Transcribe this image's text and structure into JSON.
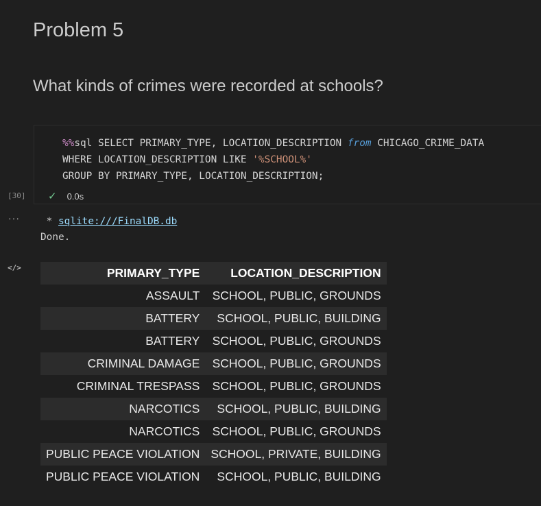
{
  "markdown": {
    "heading": "Problem 5",
    "question": "What kinds of crimes were recorded at schools?"
  },
  "code_cell": {
    "line1_magic": "%%",
    "line1_a": "sql SELECT PRIMARY_TYPE",
    "line1_b": ", LOCATION_DESCRIPTION ",
    "line1_kw": "from",
    "line1_c": " CHICAGO_CRIME_DATA",
    "line2_a": "WHERE LOCATION_DESCRIPTION LIKE ",
    "line2_str": "'%SCHOOL%'",
    "line3_a": "GROUP BY PRIMARY_TYPE",
    "line3_b": ", LOCATION_DESCRIPTION",
    "line3_semi": ";",
    "execution_count": "[30]",
    "status_time": "0.0s"
  },
  "output": {
    "connection_prefix": " * ",
    "connection_link": "sqlite:///FinalDB.db",
    "done_text": "Done."
  },
  "table": {
    "headers": [
      "PRIMARY_TYPE",
      "LOCATION_DESCRIPTION"
    ],
    "rows": [
      [
        "ASSAULT",
        "SCHOOL, PUBLIC, GROUNDS"
      ],
      [
        "BATTERY",
        "SCHOOL, PUBLIC, BUILDING"
      ],
      [
        "BATTERY",
        "SCHOOL, PUBLIC, GROUNDS"
      ],
      [
        "CRIMINAL DAMAGE",
        "SCHOOL, PUBLIC, GROUNDS"
      ],
      [
        "CRIMINAL TRESPASS",
        "SCHOOL, PUBLIC, GROUNDS"
      ],
      [
        "NARCOTICS",
        "SCHOOL, PUBLIC, BUILDING"
      ],
      [
        "NARCOTICS",
        "SCHOOL, PUBLIC, GROUNDS"
      ],
      [
        "PUBLIC PEACE VIOLATION",
        "SCHOOL, PRIVATE, BUILDING"
      ],
      [
        "PUBLIC PEACE VIOLATION",
        "SCHOOL, PUBLIC, BUILDING"
      ]
    ]
  },
  "icons": {
    "success": "check-icon",
    "output_menu": "ellipsis-icon",
    "output_renderer": "code-icon"
  },
  "colors": {
    "background": "#1f1f1f",
    "success": "#73c991",
    "link": "#9cdcfe",
    "magic": "#c586c0",
    "keyword": "#569cd6",
    "string": "#ce9178"
  }
}
